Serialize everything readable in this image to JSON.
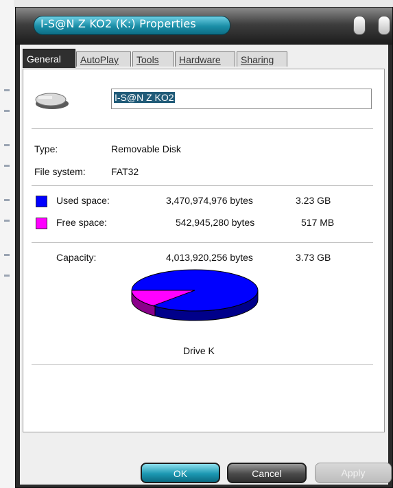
{
  "window": {
    "title": "I-S@N Z KO2 (K:) Properties"
  },
  "tabs": [
    {
      "label": "General",
      "active": true
    },
    {
      "label": "AutoPlay",
      "active": false
    },
    {
      "label": "Tools",
      "active": false
    },
    {
      "label": "Hardware",
      "active": false
    },
    {
      "label": "Sharing",
      "active": false
    }
  ],
  "general": {
    "drive_icon": "removable-drive-icon",
    "name_value": "I-S@N Z KO2",
    "type_label": "Type:",
    "type_value": "Removable Disk",
    "fs_label": "File system:",
    "fs_value": "FAT32",
    "used": {
      "label": "Used space:",
      "bytes": "3,470,974,976 bytes",
      "size": "3.23 GB",
      "color": "#0000ff"
    },
    "free": {
      "label": "Free space:",
      "bytes": "542,945,280 bytes",
      "size": "517 MB",
      "color": "#ff00ff"
    },
    "capacity": {
      "label": "Capacity:",
      "bytes": "4,013,920,256 bytes",
      "size": "3.73 GB"
    },
    "drive_caption": "Drive K",
    "used_fraction": 0.8647
  },
  "buttons": {
    "ok": "OK",
    "cancel": "Cancel",
    "apply": "Apply"
  }
}
